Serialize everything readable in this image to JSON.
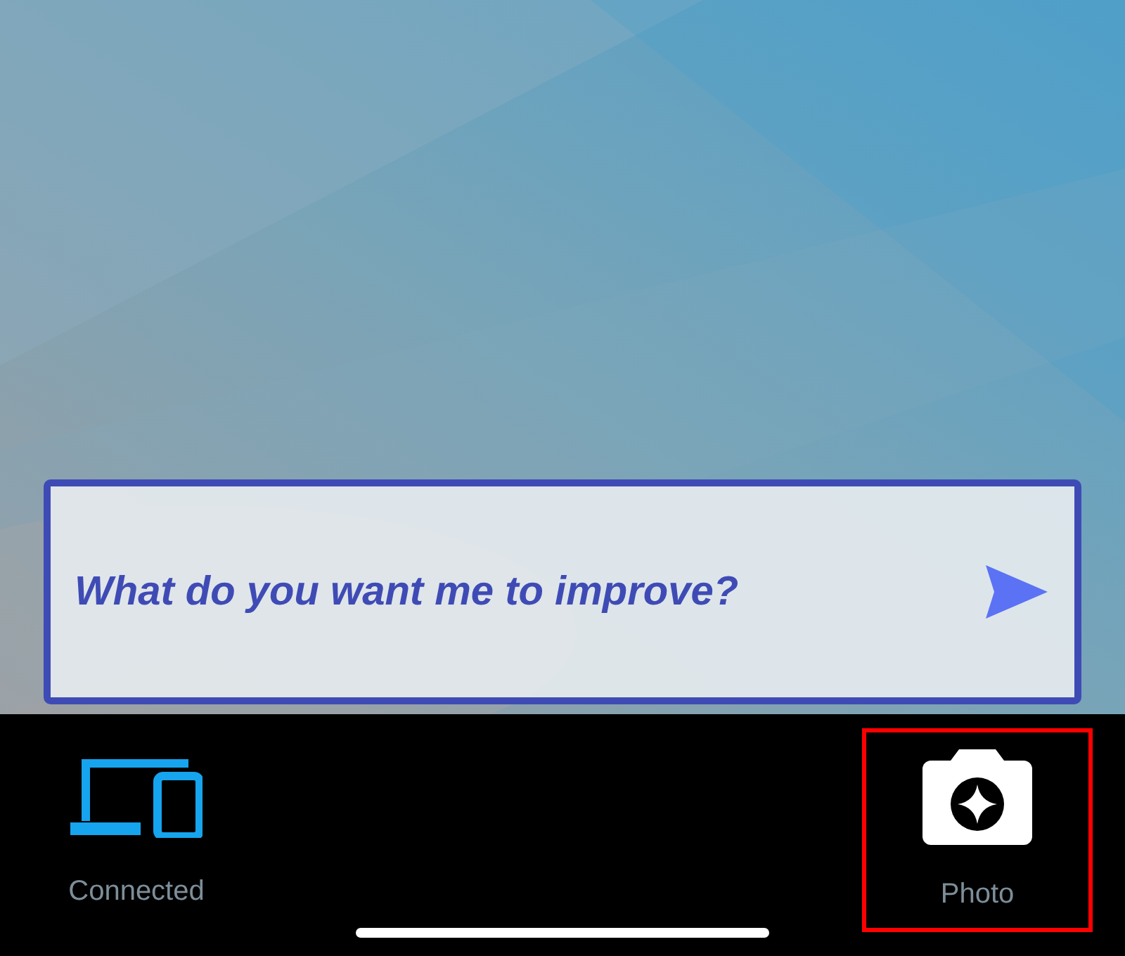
{
  "prompt": {
    "placeholder": "What do you want me to improve?"
  },
  "nav": [
    {
      "kind": "devices",
      "label": "Connected",
      "highlighted": false
    },
    {
      "kind": "camera",
      "label": "Photo",
      "highlighted": true
    }
  ]
}
